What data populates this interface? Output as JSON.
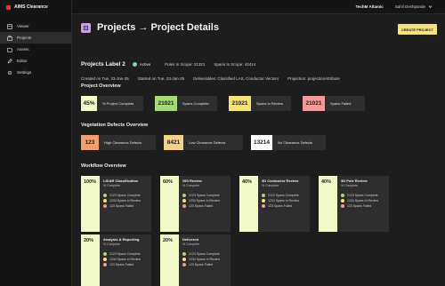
{
  "app": {
    "title": "AIMS Clearance",
    "org": "TechM Altamic",
    "user": "Sahil Deshpande"
  },
  "sidebar": {
    "items": [
      {
        "label": "Viewer",
        "icon": "viewer-icon",
        "active": false
      },
      {
        "label": "Projects",
        "icon": "projects-icon",
        "active": true
      },
      {
        "label": "Assets",
        "icon": "assets-icon",
        "active": false
      },
      {
        "label": "Editor",
        "icon": "editor-icon",
        "active": false
      },
      {
        "label": "Settings",
        "icon": "settings-icon",
        "active": false
      }
    ]
  },
  "header": {
    "title": "Projects → Project Details",
    "create_button": "CREATE PROJECT"
  },
  "project": {
    "name": "Projects Label 2",
    "status": "Active",
    "poles": "Poles In Scope: 21321",
    "spans": "Spans In Scope: 42414",
    "created": "Created on Tue, 23-Jan-25",
    "started": "Started on Tue, 23-Jan-25",
    "deliverables": "Deliverables: Classified LAS, Conductor Vectors",
    "projection": "Projection: projectionAttribute"
  },
  "overview": {
    "title": "Project Overview",
    "cards": [
      {
        "value": "45%",
        "label": "% Project Complete",
        "color": "#f1f9c8"
      },
      {
        "value": "21021",
        "label": "Spans Complete",
        "color": "#a6d97a"
      },
      {
        "value": "21021",
        "label": "Spans In Review",
        "color": "#f5e27a"
      },
      {
        "value": "21021",
        "label": "Spans Failed",
        "color": "#f19a9a"
      }
    ]
  },
  "vegetation": {
    "title": "Vegetation Defects Overview",
    "cards": [
      {
        "value": "123",
        "label": "High Clearance Defects",
        "color": "#f0a070"
      },
      {
        "value": "8421",
        "label": "Low Clearance Defects",
        "color": "#f5d08a"
      },
      {
        "value": "13214",
        "label": "No Clearance Defects",
        "color": "#ffffff"
      }
    ]
  },
  "workflow": {
    "title": "Workflow Overview",
    "sub": "% Complete",
    "stat_labels": [
      "2123 Spans Complete",
      "1234 Spans In Review",
      "123 Spans Failed"
    ],
    "stat_colors": [
      "#a6d97a",
      "#f5e27a",
      "#f19a9a"
    ],
    "cards": [
      {
        "pct": "100%",
        "title": "LiDAR Classification"
      },
      {
        "pct": "60%",
        "title": "GIS Review"
      },
      {
        "pct": "40%",
        "title": "3D Conductor Review"
      },
      {
        "pct": "40%",
        "title": "3D Pole Review"
      },
      {
        "pct": "20%",
        "title": "Analysis & Reporting"
      },
      {
        "pct": "20%",
        "title": "Delivered"
      }
    ]
  }
}
